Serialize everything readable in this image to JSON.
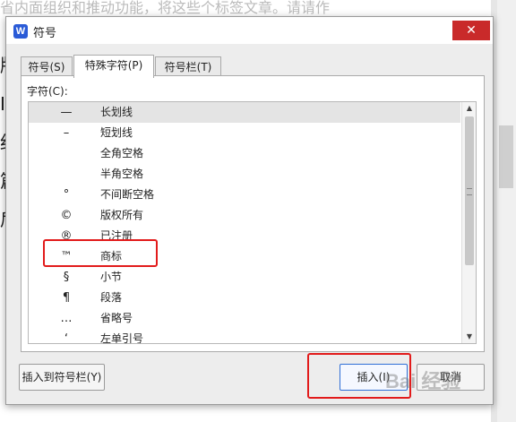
{
  "dialog": {
    "title": "符号",
    "logo_letter": "W",
    "close_glyph": "✕",
    "tabs": [
      {
        "label": "符号(S)"
      },
      {
        "label": "特殊字符(P)"
      },
      {
        "label": "符号栏(T)"
      }
    ],
    "list_label": "字符(C):",
    "characters": [
      {
        "symbol": "—",
        "name": "长划线"
      },
      {
        "symbol": "–",
        "name": "短划线"
      },
      {
        "symbol": "",
        "name": "全角空格"
      },
      {
        "symbol": "",
        "name": "半角空格"
      },
      {
        "symbol": "°",
        "name": "不间断空格"
      },
      {
        "symbol": "©",
        "name": "版权所有"
      },
      {
        "symbol": "®",
        "name": "已注册"
      },
      {
        "symbol": "™",
        "name": "商标"
      },
      {
        "symbol": "§",
        "name": "小节"
      },
      {
        "symbol": "¶",
        "name": "段落"
      },
      {
        "symbol": "…",
        "name": "省略号"
      },
      {
        "symbol": "‘",
        "name": "左单引号"
      }
    ],
    "buttons": {
      "insert_to_bar": "插入到符号栏(Y)",
      "insert": "插入(I)",
      "cancel": "取消"
    },
    "scroll_up_glyph": "▲",
    "scroll_down_glyph": "▼"
  },
  "background_doc": {
    "top_text": "省内面组织和推动功能，将这些个标签文章。请请作",
    "left_chars": [
      "版",
      "I",
      "细",
      "篇",
      "后"
    ]
  },
  "watermark": "Bai 经验",
  "colors": {
    "close_red": "#c92a2a",
    "highlight_red": "#e21b1b",
    "logo_blue": "#2a5bd7"
  }
}
